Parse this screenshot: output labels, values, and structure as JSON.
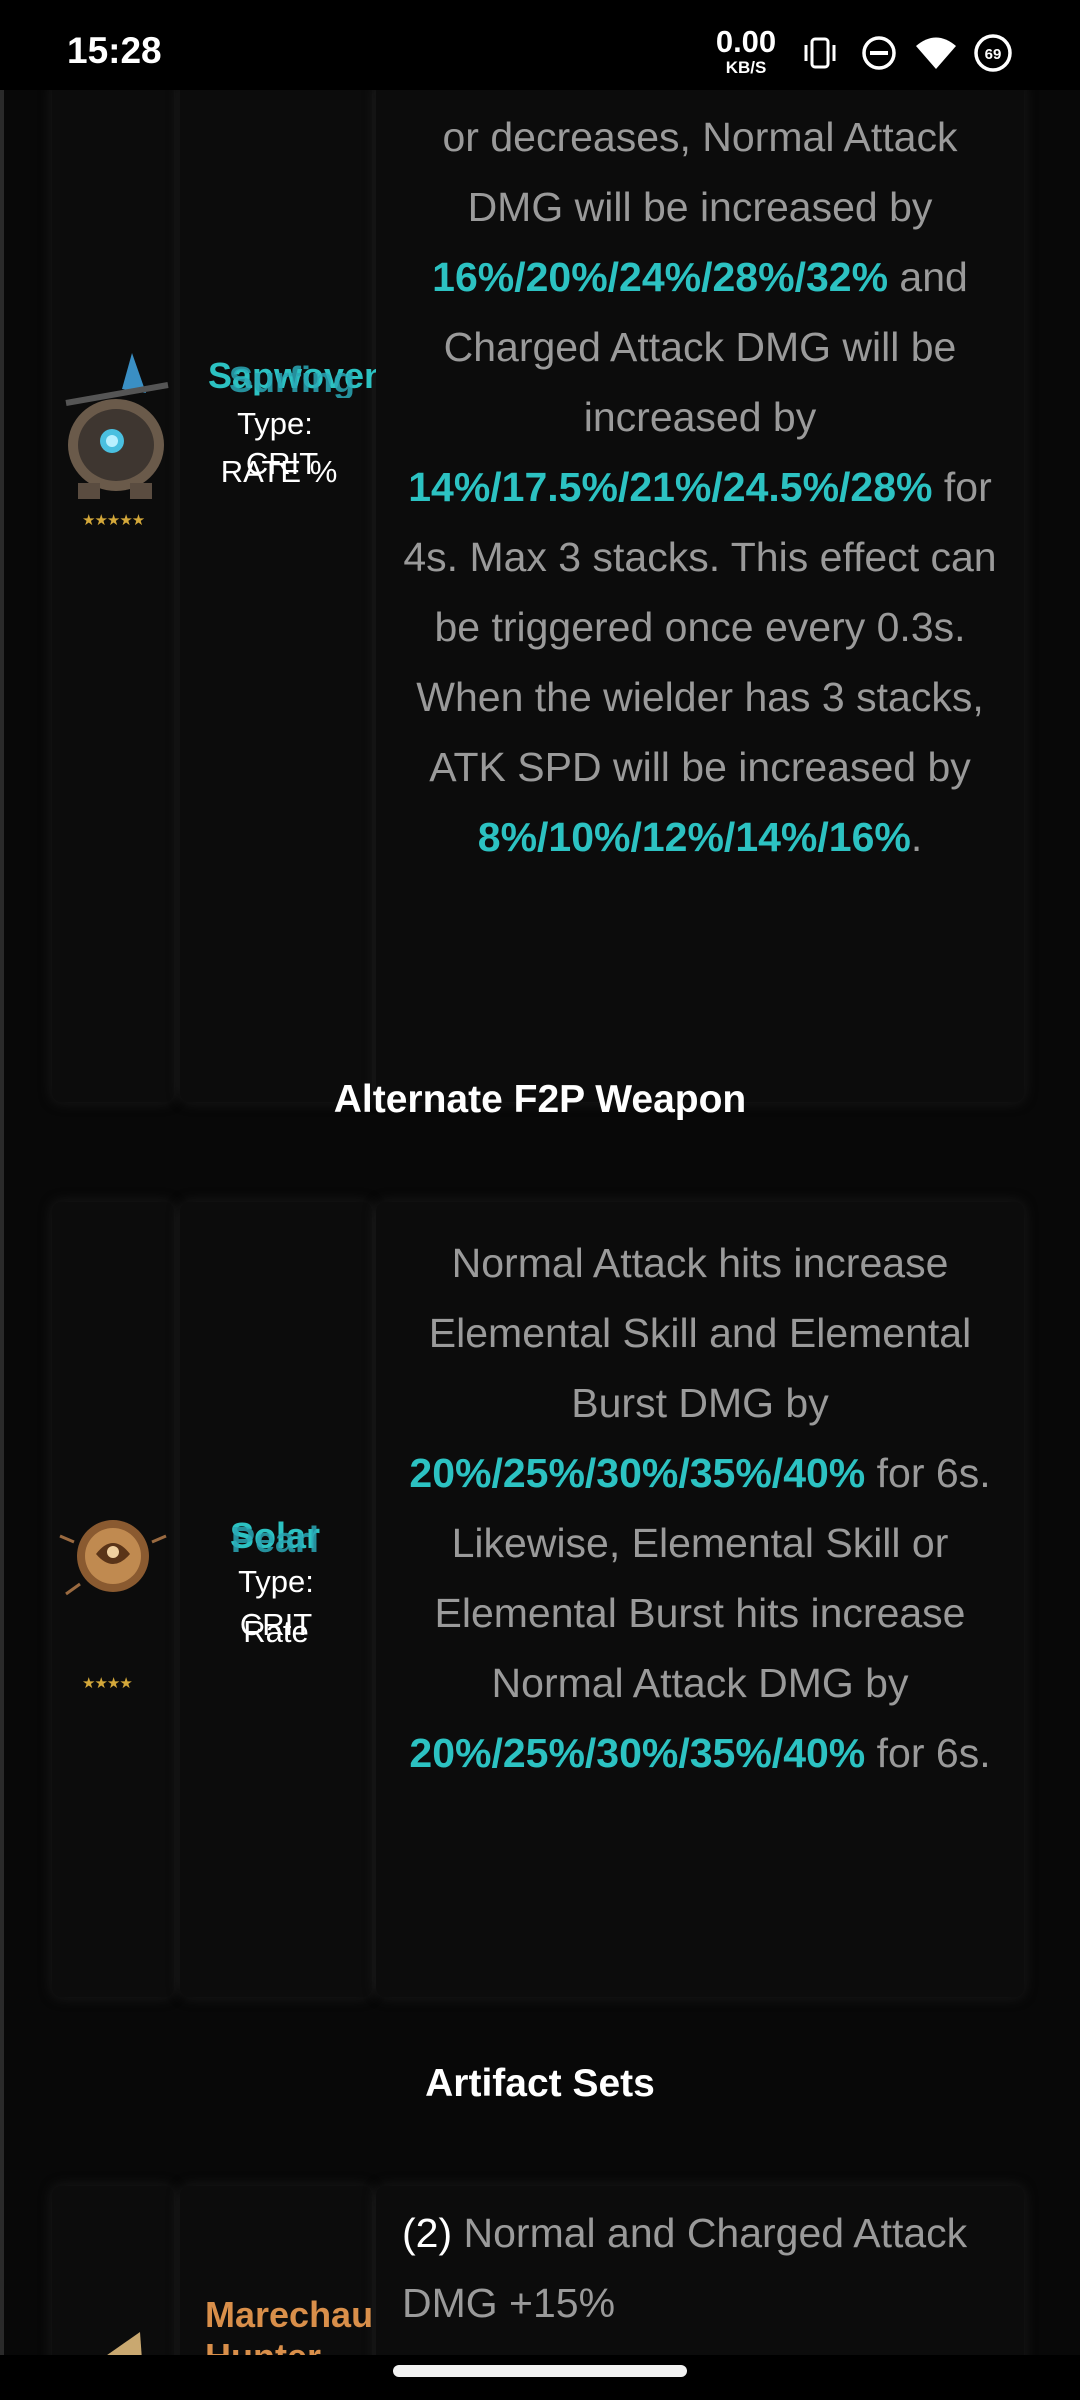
{
  "status_bar": {
    "time": "15:28",
    "net_speed": "0.00",
    "net_speed_unit": "KB/S",
    "battery_level": "69",
    "icons": [
      "vibrate-icon",
      "do-not-disturb-icon",
      "wifi-icon",
      "battery-icon"
    ]
  },
  "weapons": [
    {
      "name_layers": [
        "Sapwoven",
        "Surfing"
      ],
      "type_lines": [
        "Type:",
        "CRIT",
        "RATE %"
      ],
      "rarity": "★★★★★",
      "description_segments": [
        {
          "text": "or decreases, Normal Attack DMG will be increased by ",
          "hl": false
        },
        {
          "text": "16%/20%/24%/28%/32%",
          "hl": true
        },
        {
          "text": " and Charged Attack DMG will be increased by ",
          "hl": false
        },
        {
          "text": "14%/17.5%/21%/24.5%/28%",
          "hl": true
        },
        {
          "text": " for 4s. Max 3 stacks. This effect can be triggered once every 0.3s. When the wielder has 3 stacks, ATK SPD will be increased by ",
          "hl": false
        },
        {
          "text": "8%/10%/12%/14%/16%",
          "hl": true
        },
        {
          "text": ".",
          "hl": false
        }
      ]
    },
    {
      "name_layers": [
        "Solar",
        "Pearl"
      ],
      "type_lines": [
        "Type:",
        "CRIT",
        "Rate"
      ],
      "rarity": "★★★★",
      "description_segments": [
        {
          "text": "Normal Attack hits increase Elemental Skill and Elemental Burst DMG by ",
          "hl": false
        },
        {
          "text": "20%/25%/30%/35%/40%",
          "hl": true
        },
        {
          "text": " for 6s. Likewise, Elemental Skill or Elemental Burst hits increase Normal Attack DMG by ",
          "hl": false
        },
        {
          "text": "20%/25%/30%/35%/40%",
          "hl": true
        },
        {
          "text": " for 6s.",
          "hl": false
        }
      ]
    }
  ],
  "sections": {
    "alternate_weapon_heading": "Alternate F2P Weapon",
    "artifact_heading": "Artifact Sets"
  },
  "artifact": {
    "name": "Marechaussee Hunter",
    "piece_count": "(2)",
    "bonus_text": " Normal and Charged Attack DMG +15%"
  },
  "colors": {
    "accent_teal": "#2cc2c2",
    "artifact_orange": "#d98f4a",
    "star_gold": "#d4a83a"
  }
}
